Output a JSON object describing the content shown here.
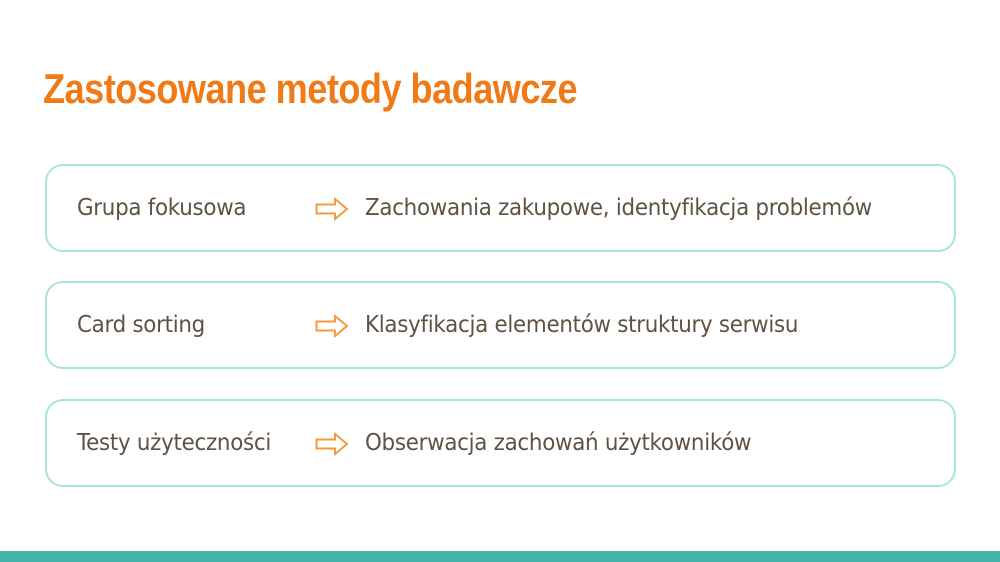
{
  "slide": {
    "title": "Zastosowane metody badawcze"
  },
  "methods": [
    {
      "name": "Grupa fokusowa",
      "description": "Zachowania zakupowe, identyfikacja problemów"
    },
    {
      "name": "Card sorting",
      "description": "Klasyfikacja elementów struktury serwisu"
    },
    {
      "name": "Testy użyteczności",
      "description": "Obserwacja zachowań użytkowników"
    }
  ],
  "colors": {
    "title": "#f07b16",
    "row_border": "#a7e5d8",
    "text": "#5f5243",
    "arrow": "#f49a3c",
    "bottom_bar": "#45b3a6"
  },
  "icons": {
    "connector": "arrow-right-outline-icon"
  }
}
